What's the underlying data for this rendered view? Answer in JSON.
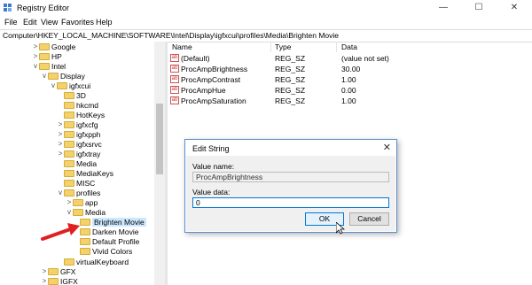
{
  "window": {
    "title": "Registry Editor",
    "minimize_glyph": "—",
    "maximize_glyph": "☐",
    "close_glyph": "✕"
  },
  "menu": [
    "File",
    "Edit",
    "View",
    "Favorites",
    "Help"
  ],
  "address": "Computer\\HKEY_LOCAL_MACHINE\\SOFTWARE\\Intel\\Display\\igfxcui\\profiles\\Media\\Brighten Movie",
  "tree": [
    {
      "label": "Google",
      "expander": ">"
    },
    {
      "label": "HP",
      "expander": ">"
    },
    {
      "label": "Intel",
      "expander": "v"
    },
    {
      "label": "Display",
      "expander": "v"
    },
    {
      "label": "igfxcui",
      "expander": "v"
    },
    {
      "label": "3D",
      "expander": ""
    },
    {
      "label": "hkcmd",
      "expander": ""
    },
    {
      "label": "HotKeys",
      "expander": ""
    },
    {
      "label": "igfxcfg",
      "expander": ">"
    },
    {
      "label": "igfxpph",
      "expander": ">"
    },
    {
      "label": "igfxsrvc",
      "expander": ">"
    },
    {
      "label": "igfxtray",
      "expander": ">"
    },
    {
      "label": "Media",
      "expander": ""
    },
    {
      "label": "MediaKeys",
      "expander": ""
    },
    {
      "label": "MISC",
      "expander": ""
    },
    {
      "label": "profiles",
      "expander": "v"
    },
    {
      "label": "app",
      "expander": ">"
    },
    {
      "label": "Media",
      "expander": "v"
    },
    {
      "label": "Brighten Movie",
      "expander": ""
    },
    {
      "label": "Darken Movie",
      "expander": ""
    },
    {
      "label": "Default Profile",
      "expander": ""
    },
    {
      "label": "Vivid Colors",
      "expander": ""
    },
    {
      "label": "virtualKeyboard",
      "expander": ""
    },
    {
      "label": "GFX",
      "expander": ">"
    },
    {
      "label": "IGFX",
      "expander": ">"
    }
  ],
  "list": {
    "columns": [
      "Name",
      "Type",
      "Data"
    ],
    "value_icon_text": "ab",
    "rows": [
      {
        "name": "(Default)",
        "type": "REG_SZ",
        "data": "(value not set)"
      },
      {
        "name": "ProcAmpBrightness",
        "type": "REG_SZ",
        "data": "30.00"
      },
      {
        "name": "ProcAmpContrast",
        "type": "REG_SZ",
        "data": "1.00"
      },
      {
        "name": "ProcAmpHue",
        "type": "REG_SZ",
        "data": "0.00"
      },
      {
        "name": "ProcAmpSaturation",
        "type": "REG_SZ",
        "data": "1.00"
      }
    ]
  },
  "dialog": {
    "title": "Edit String",
    "close_glyph": "✕",
    "value_name_label": "Value name:",
    "value_name": "ProcAmpBrightness",
    "value_data_label": "Value data:",
    "value_data": "0",
    "ok_label": "OK",
    "cancel_label": "Cancel"
  },
  "colors": {
    "arrow": "#e02020",
    "selection": "#cce8ff",
    "folder": "#f3d26b",
    "dialog_border": "#5b8fd1"
  }
}
